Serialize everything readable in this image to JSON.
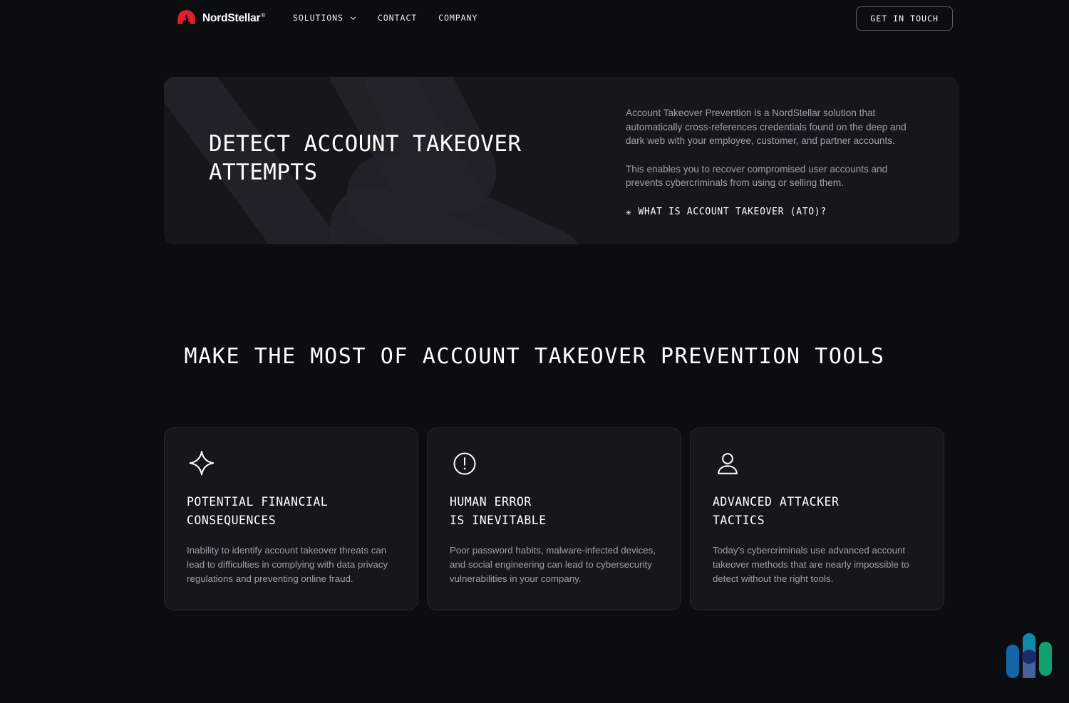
{
  "colors": {
    "page_bg": "#0b0d10",
    "card_bg": "#15171c",
    "card_border": "#24272e",
    "brand_red": "#e01e2d",
    "text_primary": "#ffffff",
    "text_muted": "#9ba2ae",
    "widget_blue": "#1266a8",
    "widget_teal": "#0f8aab",
    "widget_green": "#11a06e",
    "widget_dot": "#1c2c6b"
  },
  "header": {
    "brand": {
      "name": "NordStellar",
      "trademark": "®",
      "logo_icon": "nordstellar-mountain-logo"
    },
    "nav": [
      {
        "label": "SOLUTIONS",
        "has_dropdown": true
      },
      {
        "label": "CONTACT",
        "has_dropdown": false
      },
      {
        "label": "COMPANY",
        "has_dropdown": false
      }
    ],
    "cta_label": "GET IN TOUCH"
  },
  "hero": {
    "title": "DETECT ACCOUNT TAKEOVER\nATTEMPTS",
    "paragraphs": [
      "Account Takeover Prevention is a NordStellar solution that automatically cross-references credentials found on the deep and dark web with your employee, customer, and partner accounts.",
      "This enables you to recover compromised user accounts and prevents cybercriminals from using or selling them."
    ],
    "link": {
      "marker": "✳",
      "label": "WHAT IS ACCOUNT TAKEOVER (ATO)?"
    }
  },
  "section": {
    "heading": "MAKE THE MOST OF ACCOUNT TAKEOVER PREVENTION TOOLS",
    "cards": [
      {
        "icon": "sparkle-star-icon",
        "title": "POTENTIAL FINANCIAL\nCONSEQUENCES",
        "body": "Inability to identify account takeover threats can lead to difficulties in complying with data privacy regulations and preventing online fraud."
      },
      {
        "icon": "exclamation-circle-icon",
        "title": "HUMAN ERROR\nIS INEVITABLE",
        "body": "Poor password habits, malware-infected devices, and social engineering can lead to cybersecurity vulnerabilities in your company."
      },
      {
        "icon": "user-person-icon",
        "title": "ADVANCED ATTACKER\nTACTICS",
        "body": "Today's cybercriminals use advanced account takeover methods that are nearly impossible to detect without the right tools."
      }
    ]
  },
  "floating_widget": {
    "icon": "chat-bars-widget-icon"
  }
}
